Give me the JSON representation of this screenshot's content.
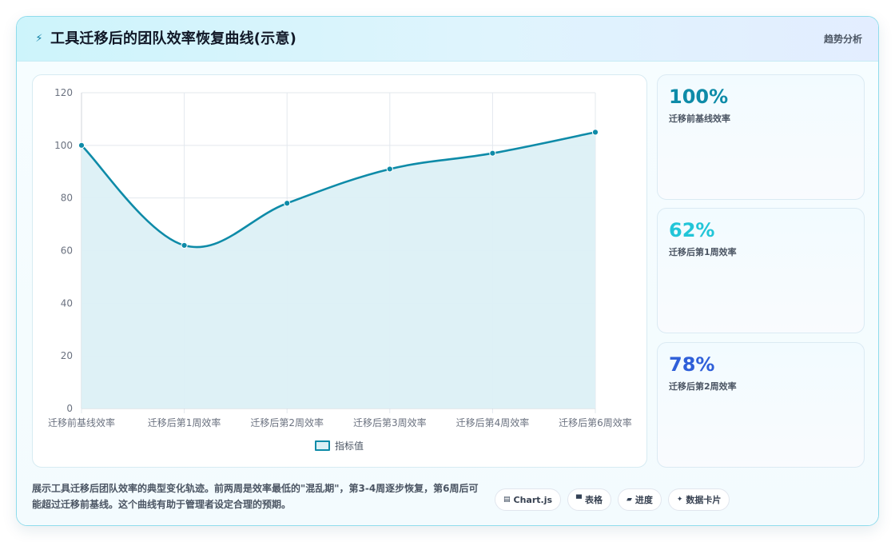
{
  "header": {
    "icon": "lightning-icon",
    "title": "工具迁移后的团队效率恢复曲线(示意)",
    "tag": "趋势分析"
  },
  "chart_data": {
    "type": "line",
    "categories": [
      "迁移前基线效率",
      "迁移后第1周效率",
      "迁移后第2周效率",
      "迁移后第3周效率",
      "迁移后第4周效率",
      "迁移后第6周效率"
    ],
    "series": [
      {
        "name": "指标值",
        "values": [
          100,
          62,
          78,
          91,
          97,
          105
        ]
      }
    ],
    "ylim": [
      0,
      120
    ],
    "yticks": [
      0,
      20,
      40,
      60,
      80,
      100,
      120
    ],
    "fill": true,
    "grid": true,
    "legend_position": "bottom",
    "colors": {
      "line": "#0e8ba8",
      "fill": "#dcf0f5",
      "grid": "#e5e7eb"
    }
  },
  "stats": [
    {
      "value": "100%",
      "label": "迁移前基线效率",
      "color": "#0e8ba8"
    },
    {
      "value": "62%",
      "label": "迁移后第1周效率",
      "color": "#22c5d8"
    },
    {
      "value": "78%",
      "label": "迁移后第2周效率",
      "color": "#2f5fd9"
    }
  ],
  "description": "展示工具迁移后团队效率的典型变化轨迹。前两周是效率最低的\"混乱期\"，第3-4周逐步恢复，第6周后可能超过迁移前基线。这个曲线有助于管理者设定合理的预期。",
  "chips": [
    {
      "icon": "chart-icon",
      "glyph": "▤",
      "label": "Chart.js"
    },
    {
      "icon": "table-icon",
      "glyph": "▀",
      "label": "表格"
    },
    {
      "icon": "progress-icon",
      "glyph": "▰",
      "label": "进度"
    },
    {
      "icon": "sparkle-icon",
      "glyph": "✦",
      "label": "数据卡片"
    }
  ]
}
